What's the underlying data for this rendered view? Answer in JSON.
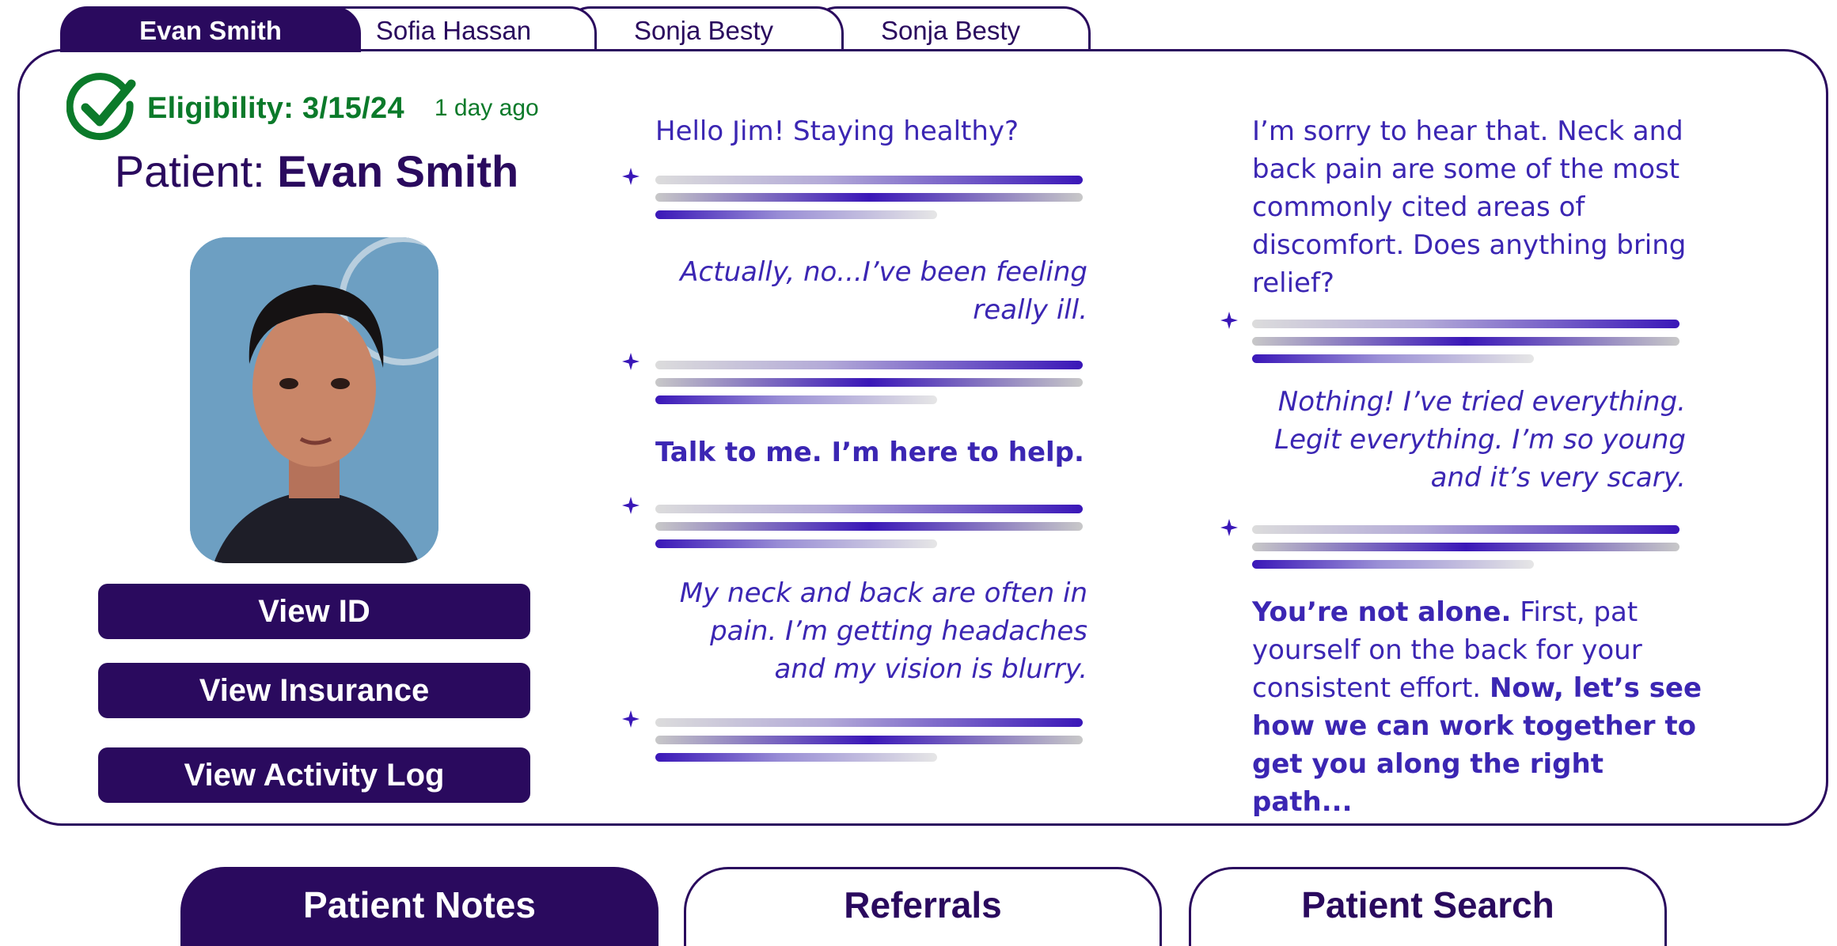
{
  "tabs": [
    {
      "label": "Evan Smith",
      "active": true
    },
    {
      "label": "Sofia Hassan",
      "active": false
    },
    {
      "label": "Sonja Besty",
      "active": false
    },
    {
      "label": "Sonja Besty",
      "active": false
    }
  ],
  "eligibility": {
    "label": "Eligibility: 3/15/24",
    "ago": "1 day ago",
    "color": "#0b7a2a"
  },
  "patient": {
    "prefix": "Patient: ",
    "name": "Evan Smith"
  },
  "photo": {
    "icon": "id-photo-icon"
  },
  "buttons": {
    "view_id": "View ID",
    "view_insurance": "View Insurance",
    "view_activity_log": "View Activity Log"
  },
  "chat": {
    "col1": [
      "Hello Jim! Staying healthy?",
      "Actually, no...I’ve been feeling really ill.",
      "Talk to me. I’m here to help.",
      "My neck and back are often in pain. I’m getting headaches and my vision is blurry."
    ],
    "col2": [
      "I’m sorry to hear that. Neck and back pain are some of the most commonly cited areas of discomfort. Does anything bring relief?",
      "Nothing! I’ve tried everything. Legit everything. I’m so young and it’s very scary."
    ],
    "last": {
      "bold1": "You’re not alone.",
      "plain": " First, pat yourself on the back for your consistent effort. ",
      "bold2": "Now, let’s see how we can work together to get you along the right path..."
    }
  },
  "bottom_nav": [
    {
      "label": "Patient Notes",
      "active": true
    },
    {
      "label": "Referrals",
      "active": false
    },
    {
      "label": "Patient Search",
      "active": false
    }
  ],
  "colors": {
    "brand": "#2a0a5e",
    "chat_text": "#3b26b3",
    "eligible": "#0b7a2a"
  }
}
